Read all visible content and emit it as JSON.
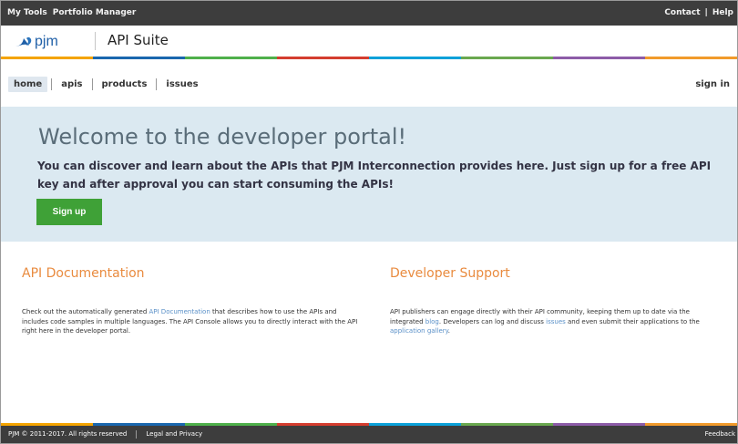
{
  "topbar": {
    "my_tools": "My Tools",
    "portfolio_manager": "Portfolio Manager",
    "contact": "Contact",
    "separator": "|",
    "help": "Help"
  },
  "branding": {
    "logo_text": "pjm",
    "suite_title": "API Suite",
    "stripe_colors": [
      "#f4a400",
      "#1a67ae",
      "#4fb04b",
      "#d43d2f",
      "#0ba1d9",
      "#6aa84f",
      "#8d5ca8",
      "#f19a2b"
    ]
  },
  "nav": {
    "items": [
      "home",
      "apis",
      "products",
      "issues"
    ],
    "sign_in": "sign in"
  },
  "hero": {
    "title": "Welcome to the developer portal!",
    "text": "You can discover and learn about the APIs that PJM Interconnection provides here. Just sign up for a free API key and after approval you can start consuming the APIs!",
    "button": "Sign up"
  },
  "sections": {
    "api_documentation": {
      "title": "API Documentation",
      "text_before": "Check out the automatically generated ",
      "link": "API Documentation",
      "text_after": " that describes how to use the APIs and includes code samples in multiple languages. The API Console allows you to directly interact with the API right here in the developer portal."
    },
    "developer_support": {
      "title": "Developer Support",
      "text_1": "API publishers can engage directly with their API community, keeping them up to date via the integrated ",
      "link_blog": "blog",
      "text_2": ". Developers can log and discuss ",
      "link_issues": "issues",
      "text_3": " and even submit their applications to the ",
      "link_gallery": "application gallery",
      "text_4": "."
    }
  },
  "footer": {
    "copyright": "PJM © 2011-2017. All rights reserved",
    "legal": "Legal and Privacy",
    "feedback": "Feedback"
  }
}
